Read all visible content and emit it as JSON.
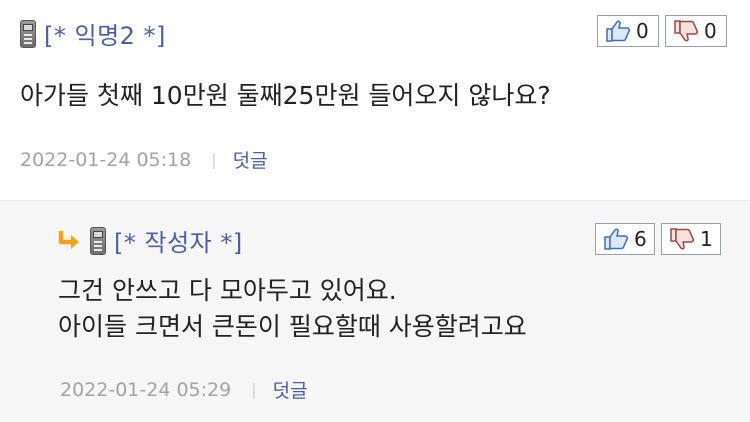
{
  "comments": [
    {
      "nick": "[* 익명2 *]",
      "likes": "0",
      "dislikes": "0",
      "body": [
        "아가들 첫째 10만원 둘째25만원 들어오지 않나요?"
      ],
      "date": "2022-01-24 05:18",
      "reply_label": "덧글"
    },
    {
      "nick": "[* 작성자 *]",
      "likes": "6",
      "dislikes": "1",
      "body": [
        "그건 안쓰고 다 모아두고 있어요.",
        "아이들 크면서 큰돈이 필요할때 사용할려고요"
      ],
      "date": "2022-01-24 05:29",
      "reply_label": "덧글"
    }
  ],
  "meta_separator": "|",
  "icons": {
    "author_icon": "mobile-phone-icon",
    "reply_icon": "reply-arrow-icon",
    "like_icon": "thumbs-up-icon",
    "dislike_icon": "thumbs-down-icon"
  },
  "colors": {
    "nick": "#4a5fa6",
    "reply_link": "#4a5fa6",
    "date": "#a3a3a3",
    "reply_background": "#f6f6f6",
    "arrow": "#f0a21a",
    "thumb_up": "#3a6fc0",
    "thumb_down": "#c0392b"
  }
}
